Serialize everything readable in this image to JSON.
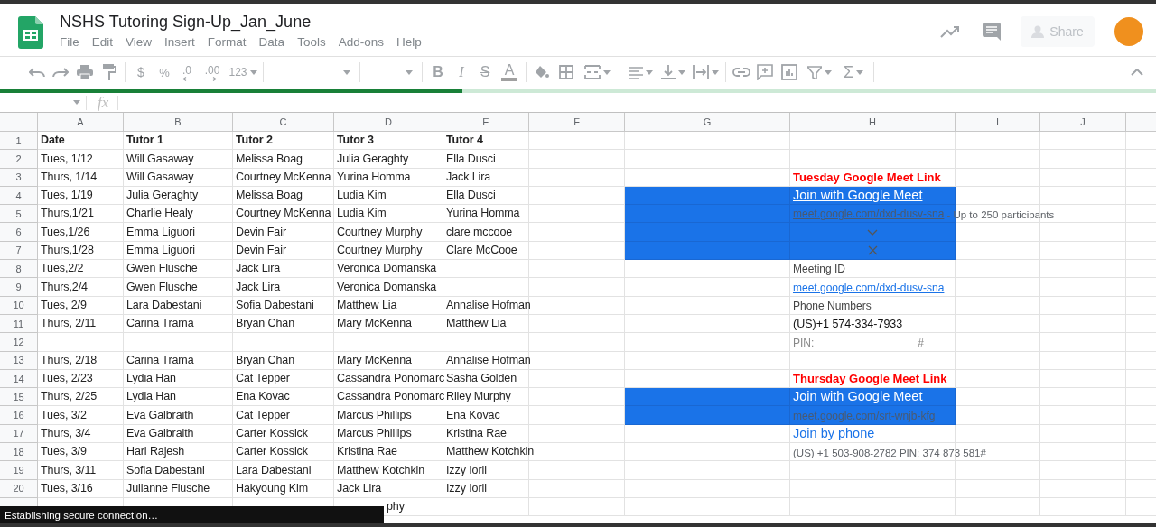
{
  "app": {
    "title": "NSHS Tutoring Sign-Up_Jan_June",
    "share_label": "Share"
  },
  "menu": [
    "File",
    "Edit",
    "View",
    "Insert",
    "Format",
    "Data",
    "Tools",
    "Add-ons",
    "Help"
  ],
  "toolbar": {
    "currency": "$",
    "percent": "%",
    "decrease_decimals": ".0",
    "increase_decimals": ".00",
    "more_formats": "123",
    "bold": "B",
    "italic": "I",
    "strikethrough": "S",
    "text_color": "A",
    "functions": "Σ"
  },
  "loading_bar": {
    "level": 0.4
  },
  "formula_bar": {
    "function_label": "fx"
  },
  "columns": [
    "A",
    "B",
    "C",
    "D",
    "E",
    "F",
    "G",
    "H",
    "I",
    "J"
  ],
  "rows": [
    {
      "number": "1",
      "header": true,
      "highlighted": false,
      "cells": {
        "A": "Date",
        "B": "Tutor 1",
        "C": "Tutor 2",
        "D": "Tutor 3",
        "E": "Tutor 4"
      }
    },
    {
      "number": "2",
      "header": false,
      "highlighted": false,
      "cells": {
        "A": "Tues, 1/12",
        "B": "Will Gasaway",
        "C": "Melissa Boag",
        "D": "Julia Geraghty",
        "E": "Ella Dusci"
      }
    },
    {
      "number": "3",
      "header": false,
      "highlighted": false,
      "cells": {
        "A": "Thurs, 1/14",
        "B": "Will Gasaway",
        "C": "Courtney McKenna",
        "D": "Yurina Homma",
        "E": "Jack Lira"
      },
      "h": {
        "kind": "heading",
        "text": "Tuesday Google Meet Link"
      }
    },
    {
      "number": "4",
      "header": false,
      "highlighted": true,
      "cells": {
        "A": "Tues, 1/19",
        "B": "Julia Geraghty",
        "C": "Melissa Boag",
        "D": "Ludia Kim",
        "E": "Ella Dusci"
      },
      "h": {
        "kind": "join",
        "text": "Join with Google Meet"
      }
    },
    {
      "number": "5",
      "header": false,
      "highlighted": true,
      "cells": {
        "A": "Thurs,1/21",
        "B": "Charlie Healy",
        "C": "Courtney McKenna",
        "D": "Ludia Kim",
        "E": "Yurina Homma"
      },
      "h": {
        "kind": "link_note",
        "text": "meet.google.com/dxd-dusv-sna",
        "note": "- Up to 250 participants"
      }
    },
    {
      "number": "6",
      "header": false,
      "highlighted": true,
      "cells": {
        "A": "Tues,1/26",
        "B": "Emma Liguori",
        "C": "Devin Fair",
        "D": "Courtney Murphy",
        "E": "clare mccooe"
      },
      "h": {
        "kind": "chevron"
      }
    },
    {
      "number": "7",
      "header": false,
      "highlighted": true,
      "cells": {
        "A": "Thurs,1/28",
        "B": "Emma Liguori",
        "C": "Devin Fair",
        "D": "Courtney Murphy",
        "E": "Clare McCooe"
      },
      "h": {
        "kind": "close"
      }
    },
    {
      "number": "8",
      "header": false,
      "highlighted": false,
      "cells": {
        "A": "Tues,2/2",
        "B": "Gwen Flusche",
        "C": "Jack Lira",
        "D": "Veronica Domanska"
      },
      "h": {
        "kind": "label",
        "text": "Meeting ID"
      }
    },
    {
      "number": "9",
      "header": false,
      "highlighted": false,
      "cells": {
        "A": "Thurs,2/4",
        "B": "Gwen Flusche",
        "C": "Jack Lira",
        "D": "Veronica Domanska"
      },
      "h": {
        "kind": "link",
        "text": "meet.google.com/dxd-dusv-sna"
      }
    },
    {
      "number": "10",
      "header": false,
      "highlighted": false,
      "cells": {
        "A": "Tues, 2/9",
        "B": "Lara Dabestani",
        "C": "Sofia Dabestani",
        "D": "Matthew Lia",
        "E": "Annalise Hofman"
      },
      "h": {
        "kind": "label",
        "text": "Phone Numbers"
      }
    },
    {
      "number": "11",
      "header": false,
      "highlighted": false,
      "cells": {
        "A": "Thurs, 2/11",
        "B": "Carina Trama",
        "C": "Bryan Chan",
        "D": "Mary McKenna",
        "E": "Matthew Lia"
      },
      "h": {
        "kind": "phone",
        "text": "(US)+1 574-334-7933"
      }
    },
    {
      "number": "12",
      "highlighted": false,
      "h": {
        "kind": "pin",
        "text": "PIN:",
        "suffix": "#"
      }
    },
    {
      "number": "13",
      "header": false,
      "highlighted": false,
      "cells": {
        "A": "Thurs, 2/18",
        "B": "Carina Trama",
        "C": "Bryan Chan",
        "D": "Mary McKenna",
        "E": "Annalise Hofman"
      }
    },
    {
      "number": "14",
      "header": false,
      "highlighted": false,
      "cells": {
        "A": "Tues, 2/23",
        "B": "Lydia Han",
        "C": "Cat Tepper",
        "D": "Cassandra Ponomarc",
        "E": "Sasha Golden"
      },
      "h": {
        "kind": "heading",
        "text": "Thursday Google Meet Link"
      }
    },
    {
      "number": "15",
      "header": false,
      "highlighted": true,
      "cells": {
        "A": "Thurs, 2/25",
        "B": "Lydia Han",
        "C": "Ena Kovac",
        "D": "Cassandra Ponomarc",
        "E": "Riley Murphy"
      },
      "h": {
        "kind": "join",
        "text": "Join with Google Meet"
      }
    },
    {
      "number": "16",
      "header": false,
      "highlighted": true,
      "cells": {
        "A": "Tues, 3/2",
        "B": "Eva Galbraith",
        "C": "Cat Tepper",
        "D": "Marcus Phillips",
        "E": "Ena Kovac"
      },
      "h": {
        "kind": "dark_link",
        "text": "meet.google.com/srt-wnjb-kfg"
      }
    },
    {
      "number": "17",
      "header": false,
      "highlighted": false,
      "cells": {
        "A": "Thurs, 3/4",
        "B": "Eva Galbraith",
        "C": "Carter Kossick",
        "D": "Marcus Phillips",
        "E": "Kristina Rae"
      },
      "h": {
        "kind": "phone_link",
        "text": "Join by phone"
      }
    },
    {
      "number": "18",
      "header": false,
      "highlighted": false,
      "cells": {
        "A": "Tues, 3/9",
        "B": "Hari Rajesh",
        "C": "Carter Kossick",
        "D": "Kristina Rae",
        "E": "Matthew Kotchkin"
      },
      "h": {
        "kind": "note",
        "text": "(US) +1 503-908-2782 PIN: 374 873 581#"
      }
    },
    {
      "number": "19",
      "header": false,
      "highlighted": false,
      "cells": {
        "A": "Thurs, 3/11",
        "B": "Sofia Dabestani",
        "C": "Lara Dabestani",
        "D": "Matthew Kotchkin",
        "E": "Izzy Iorii"
      }
    },
    {
      "number": "20",
      "header": false,
      "highlighted": false,
      "cells": {
        "A": "Tues, 3/16",
        "B": "Julianne Flusche",
        "C": "Hakyoung Kim",
        "D": "Jack Lira",
        "E": "Izzy Iorii"
      }
    },
    {
      "header": false,
      "highlighted": false,
      "cells": {
        "D": "phy"
      }
    }
  ],
  "status_toast": "Establishing secure connection…"
}
